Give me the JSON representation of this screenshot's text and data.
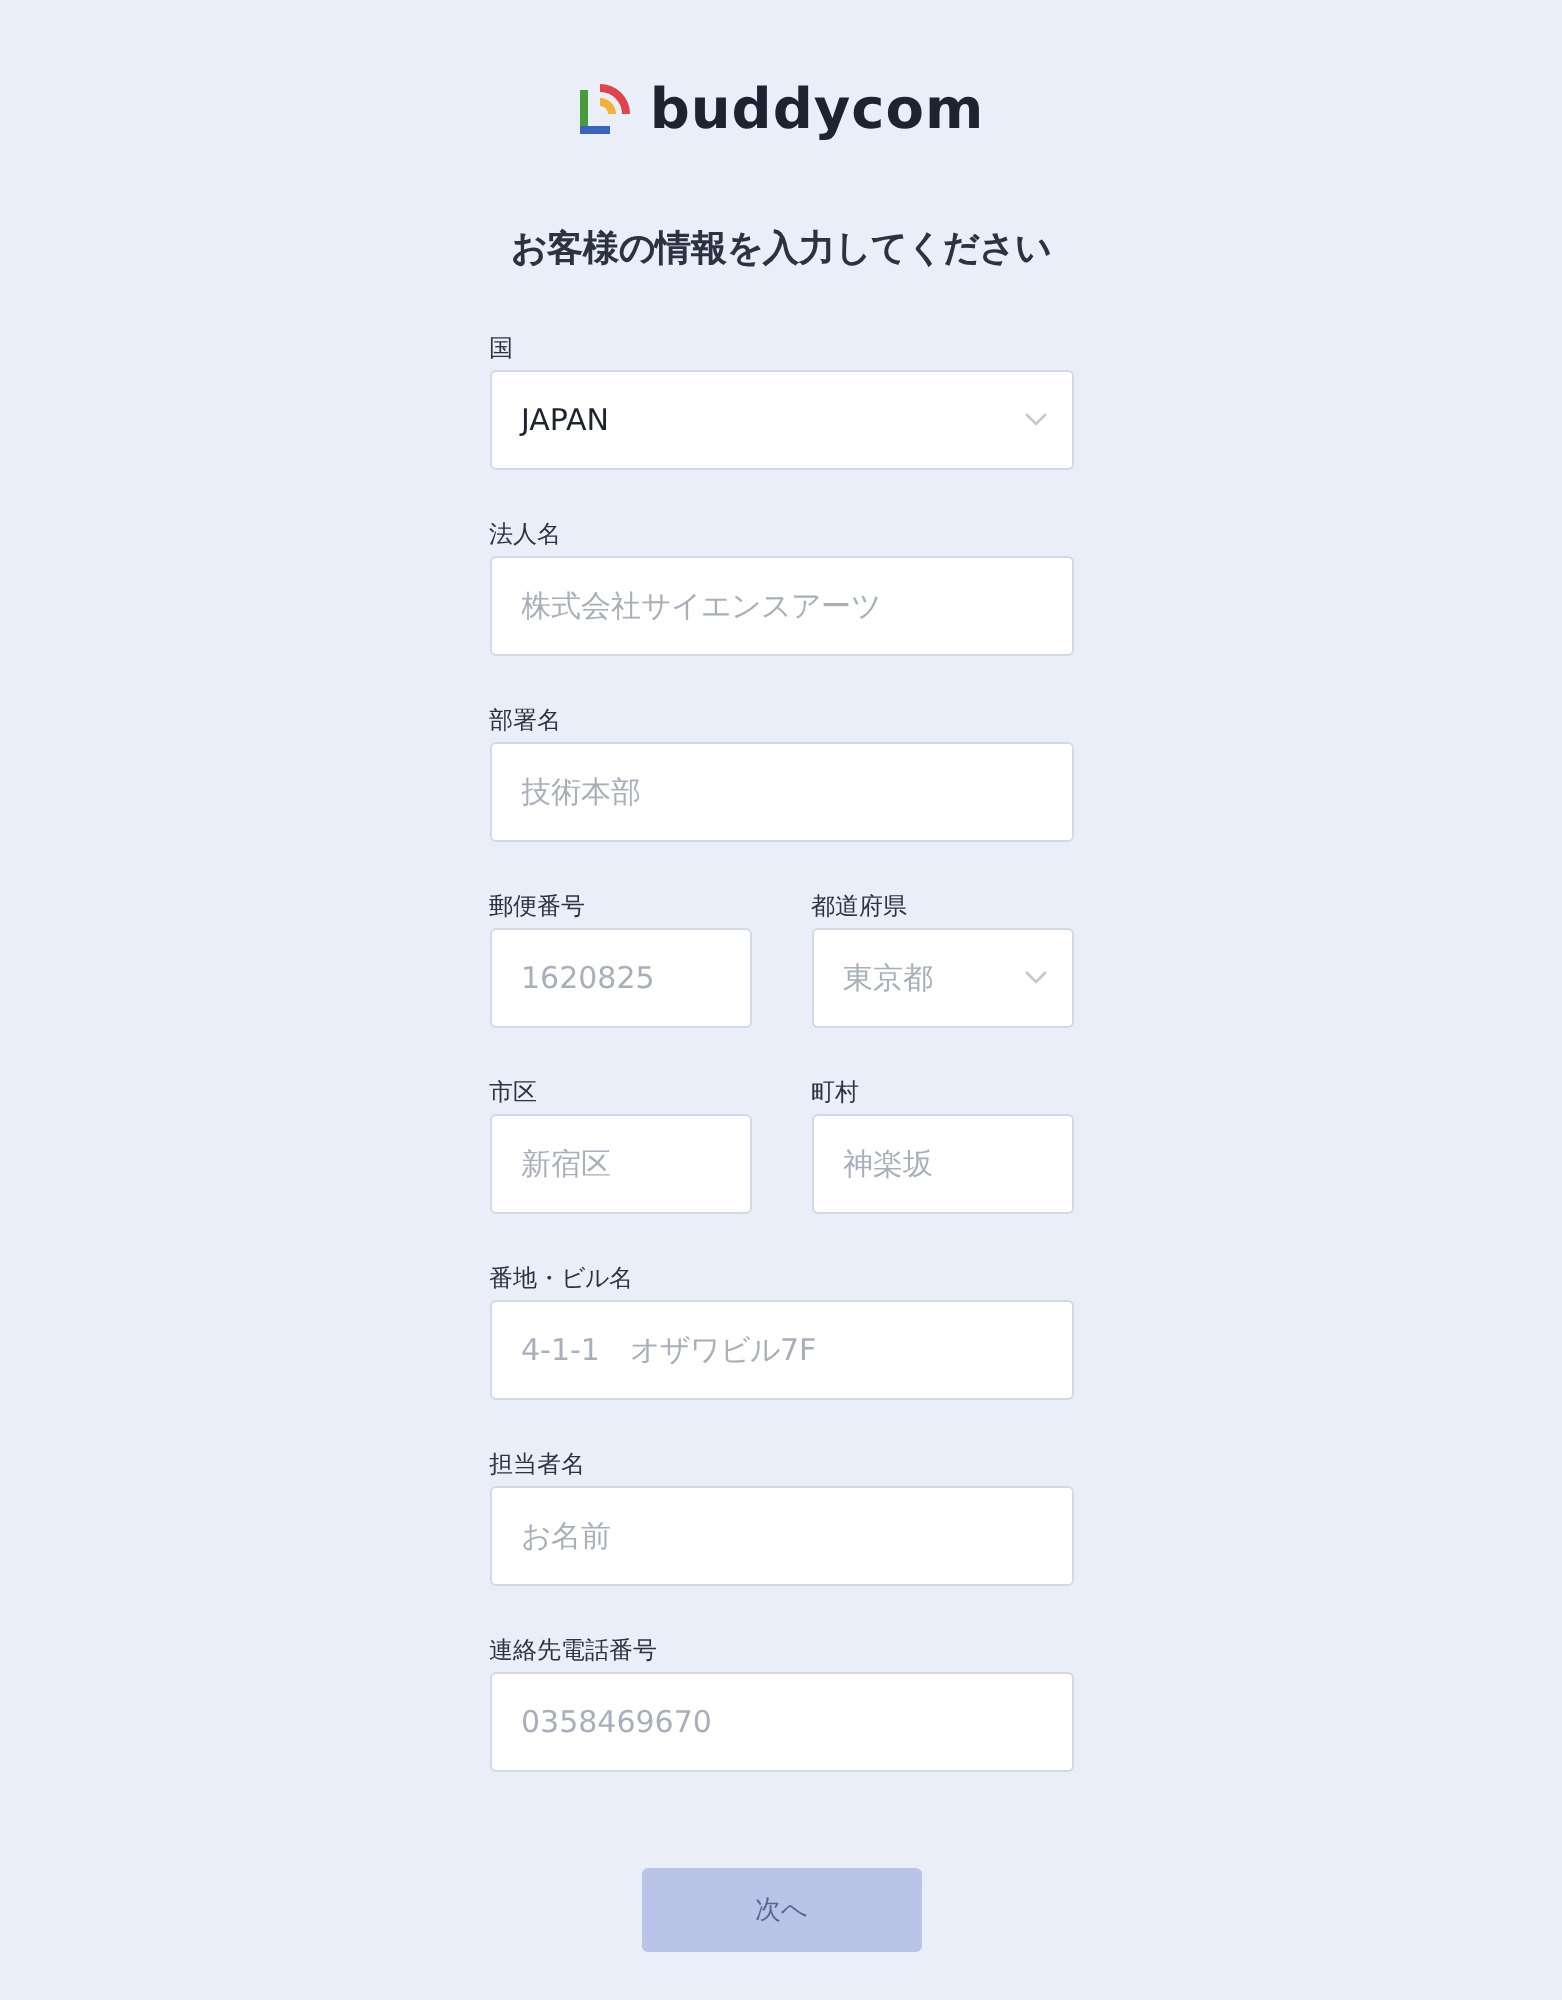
{
  "logo": {
    "text": "buddycom"
  },
  "title": "お客様の情報を入力してください",
  "rows": [
    {
      "fields": [
        {
          "label": "国",
          "kind": "select",
          "value": "JAPAN"
        }
      ]
    },
    {
      "fields": [
        {
          "label": "法人名",
          "kind": "input",
          "placeholder": "株式会社サイエンスアーツ"
        }
      ]
    },
    {
      "fields": [
        {
          "label": "部署名",
          "kind": "input",
          "placeholder": "技術本部"
        }
      ]
    },
    {
      "fields": [
        {
          "label": "郵便番号",
          "kind": "input",
          "placeholder": "1620825"
        },
        {
          "label": "都道府県",
          "kind": "select",
          "placeholder": "東京都"
        }
      ]
    },
    {
      "fields": [
        {
          "label": "市区",
          "kind": "input",
          "placeholder": "新宿区"
        },
        {
          "label": "町村",
          "kind": "input",
          "placeholder": "神楽坂"
        }
      ]
    },
    {
      "fields": [
        {
          "label": "番地・ビル名",
          "kind": "input",
          "placeholder": "4-1-1　オザワビル7F"
        }
      ]
    },
    {
      "fields": [
        {
          "label": "担当者名",
          "kind": "input",
          "placeholder": "お名前"
        }
      ]
    },
    {
      "fields": [
        {
          "label": "連絡先電話番号",
          "kind": "input",
          "placeholder": "0358469670"
        }
      ]
    }
  ],
  "next_button": {
    "label": "次へ",
    "disabled": true
  }
}
